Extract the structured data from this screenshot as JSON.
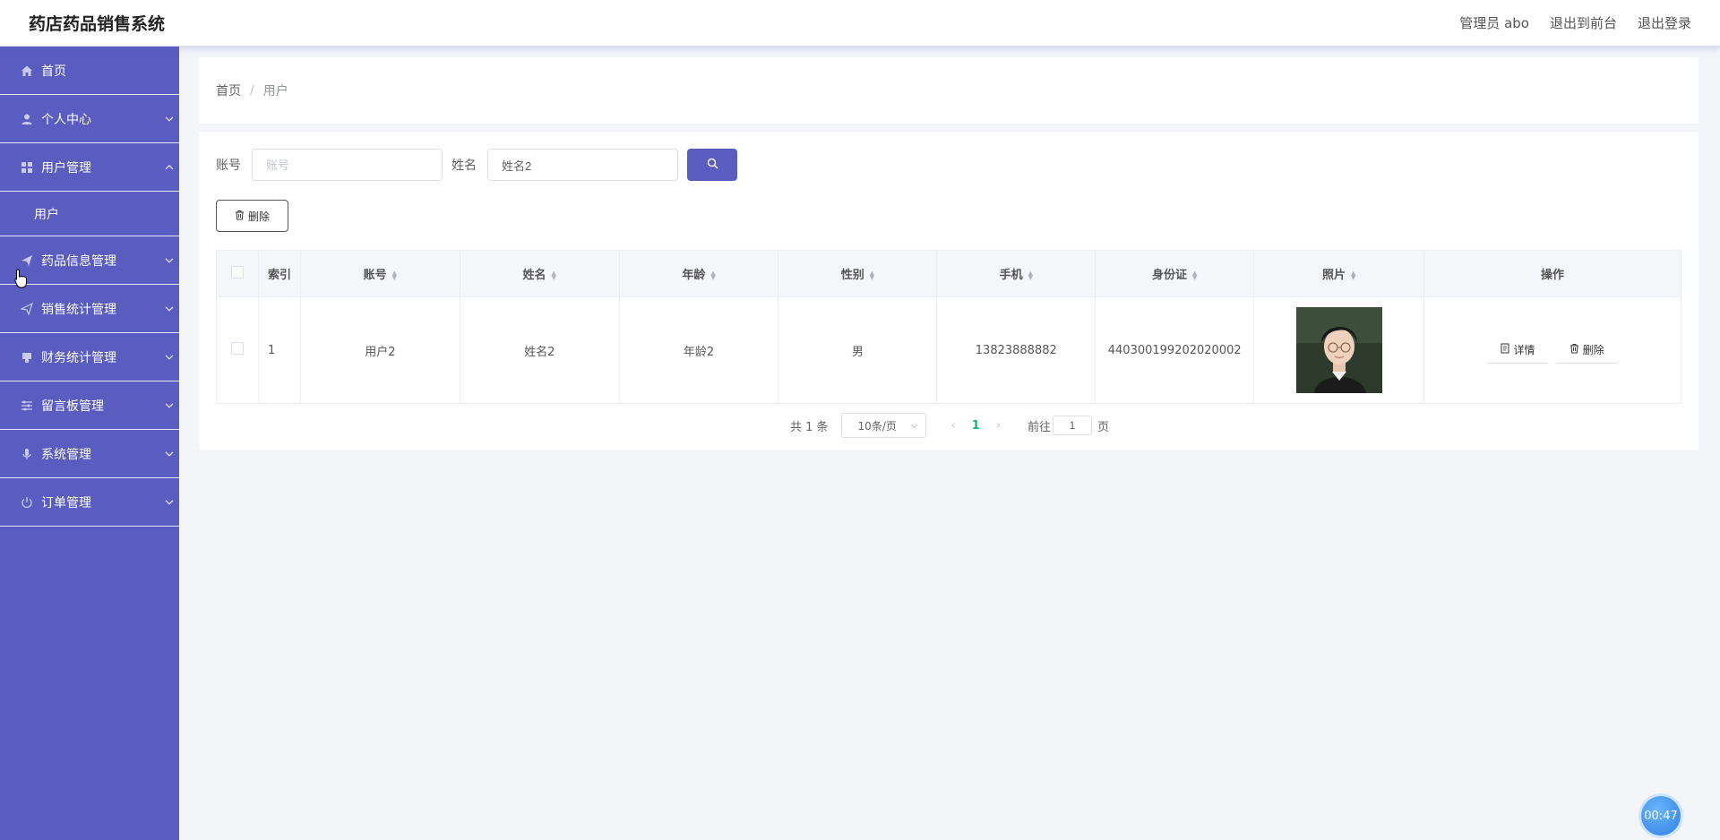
{
  "header": {
    "app_title": "药店药品销售系统",
    "admin_label": "管理员 abo",
    "exit_front_label": "退出到前台",
    "logout_label": "退出登录"
  },
  "sidebar": {
    "items": [
      {
        "label": "首页",
        "icon": "home-icon"
      },
      {
        "label": "个人中心",
        "icon": "user-icon"
      },
      {
        "label": "用户管理",
        "icon": "grid-icon"
      },
      {
        "label": "用户",
        "icon": ""
      },
      {
        "label": "药品信息管理",
        "icon": "send-icon"
      },
      {
        "label": "销售统计管理",
        "icon": "send-icon"
      },
      {
        "label": "财务统计管理",
        "icon": "box-icon"
      },
      {
        "label": "留言板管理",
        "icon": "sliders-icon"
      },
      {
        "label": "系统管理",
        "icon": "mic-icon"
      },
      {
        "label": "订单管理",
        "icon": "power-icon"
      }
    ]
  },
  "breadcrumb": {
    "home": "首页",
    "separator": "/",
    "current": "用户"
  },
  "search": {
    "account_label": "账号",
    "account_placeholder": "账号",
    "account_value": "",
    "name_label": "姓名",
    "name_placeholder": "姓名",
    "name_value": "姓名2"
  },
  "toolbar": {
    "delete_label": "删除"
  },
  "table": {
    "columns": [
      "索引",
      "账号",
      "姓名",
      "年龄",
      "性别",
      "手机",
      "身份证",
      "照片",
      "操作"
    ],
    "rows": [
      {
        "index": "1",
        "account": "用户2",
        "name": "姓名2",
        "age": "年龄2",
        "gender": "男",
        "phone": "13823888882",
        "id_card": "440300199202020002",
        "detail_label": "详情",
        "delete_label": "删除"
      }
    ]
  },
  "pagination": {
    "total_text": "共 1 条",
    "page_size": "10条/页",
    "current_page": "1",
    "goto_prefix": "前往",
    "goto_value": "1",
    "goto_suffix": "页"
  },
  "timer": {
    "text": "00:47"
  },
  "colors": {
    "sidebar_bg": "#5a5dbf",
    "primary": "#5a5dbf",
    "active_page": "#1eb36b"
  }
}
